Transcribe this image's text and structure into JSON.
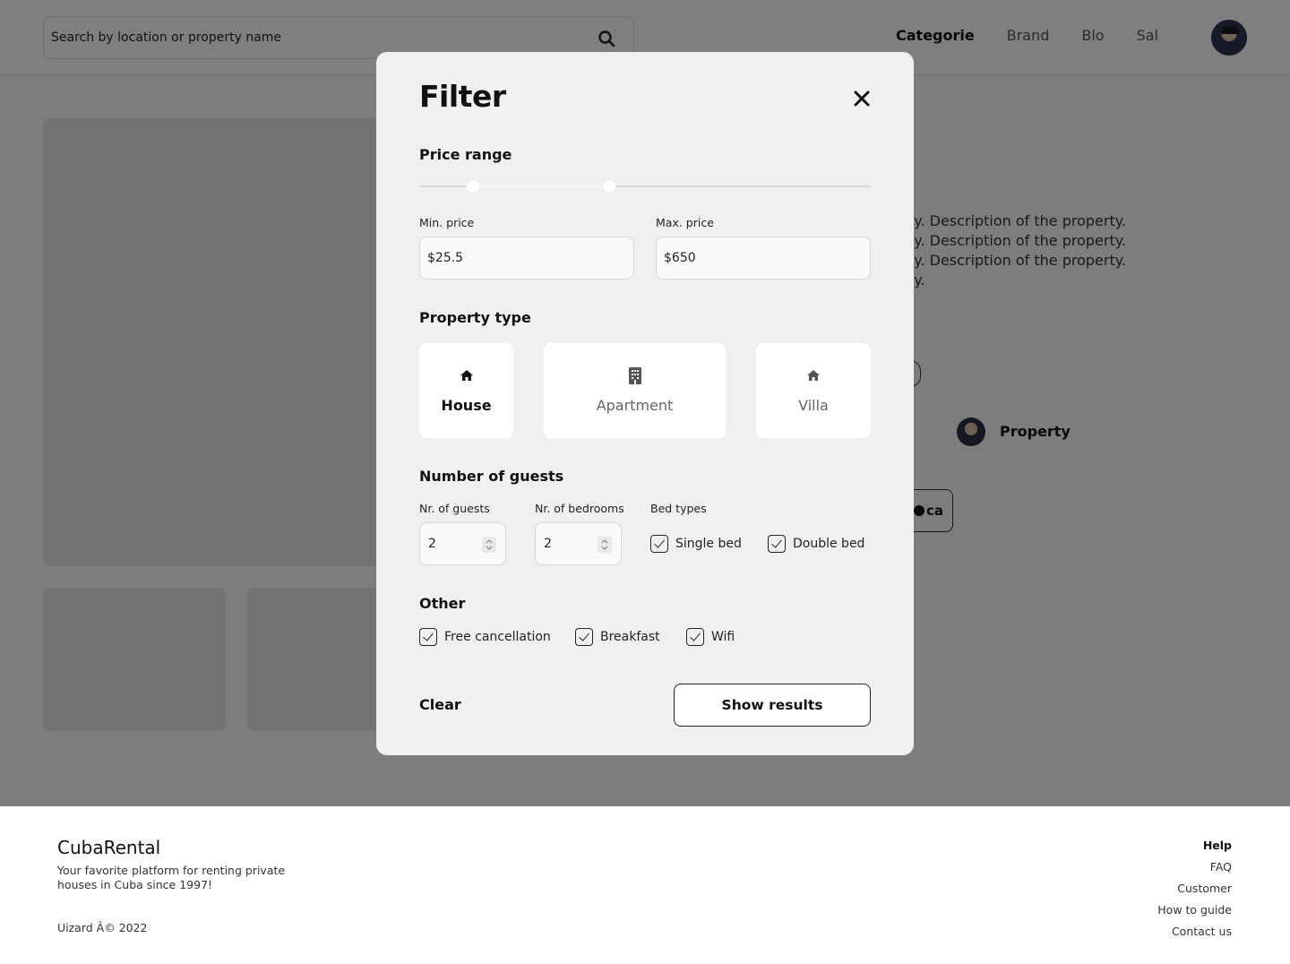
{
  "header": {
    "search_placeholder": "Search by location or property name",
    "nav": [
      "Categorie",
      "Brand",
      "Blo",
      "Sal"
    ],
    "active_nav": "Categorie"
  },
  "property": {
    "description": "ty. Description of the property.\nty. Description of the property.\nty. Description of the property.\nty.",
    "owner_name": "Property",
    "action_label": "ca"
  },
  "filter": {
    "title": "Filter",
    "price_range_title": "Price range",
    "price_slider": {
      "min_fraction": 0.12,
      "max_fraction": 0.42
    },
    "min_price_label": "Min. price",
    "min_price_value": "$25.5",
    "max_price_label": "Max. price",
    "max_price_value": "$650",
    "property_type_title": "Property type",
    "property_types": [
      {
        "label": "House",
        "icon": "home-icon",
        "selected": true
      },
      {
        "label": "Apartment",
        "icon": "building-icon",
        "selected": false
      },
      {
        "label": "Villa",
        "icon": "home-icon",
        "selected": false
      }
    ],
    "guests_title": "Number of guests",
    "guests_label": "Nr. of guests",
    "guests_value": "2",
    "bedrooms_label": "Nr. of bedrooms",
    "bedrooms_value": "2",
    "bed_types_label": "Bed types",
    "bed_types": [
      {
        "label": "Single bed",
        "checked": true
      },
      {
        "label": "Double bed",
        "checked": true
      }
    ],
    "other_title": "Other",
    "other_options": [
      {
        "label": "Free cancellation",
        "checked": true
      },
      {
        "label": "Breakfast",
        "checked": true
      },
      {
        "label": "Wifi",
        "checked": true
      }
    ],
    "clear_label": "Clear",
    "show_results_label": "Show results"
  },
  "footer": {
    "brand": "CubaRental",
    "tagline": "Your favorite platform for renting private houses in Cuba since 1997!",
    "copyright": "Uizard Â© 2022",
    "links_heading": "Help",
    "links": [
      "FAQ",
      "Customer",
      "How to guide",
      "Contact us"
    ]
  },
  "colors": {
    "overlay": "#000000",
    "modal_bg": "#f0f0f0",
    "text_primary": "#111111",
    "text_muted": "#666666"
  }
}
